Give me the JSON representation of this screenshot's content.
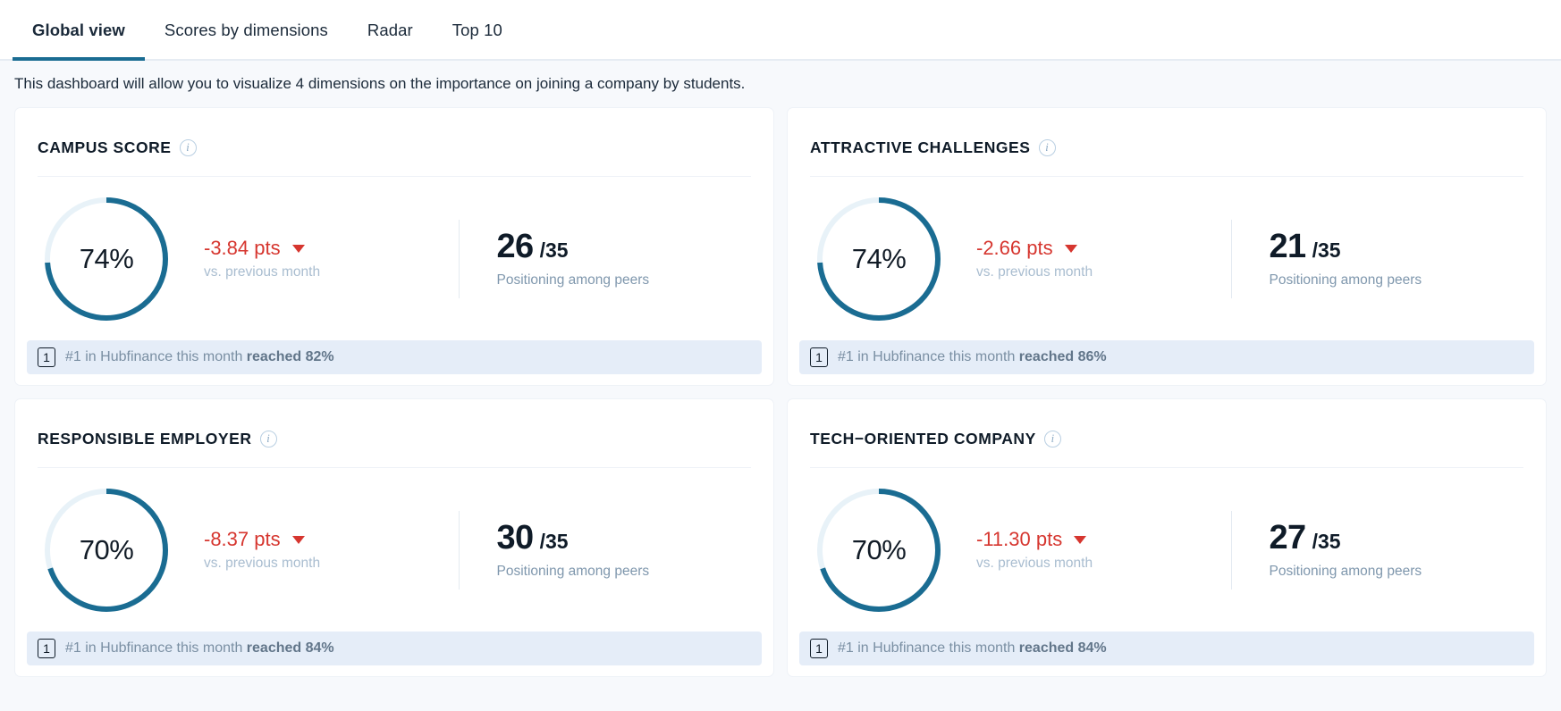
{
  "tabs": [
    {
      "label": "Global view",
      "active": true
    },
    {
      "label": "Scores by dimensions",
      "active": false
    },
    {
      "label": "Radar",
      "active": false
    },
    {
      "label": "Top 10",
      "active": false
    }
  ],
  "intro": "This dashboard will allow you to visualize 4 dimensions on the importance on joining a company by students.",
  "colors": {
    "accent": "#1a6c92",
    "track": "#e8f2f8",
    "negative": "#d6362f",
    "banner_bg": "#e5edf8"
  },
  "cards": [
    {
      "title": "CAMPUS SCORE",
      "score_pct": 74,
      "score_label": "74%",
      "delta": "-3.84 pts",
      "delta_caption": "vs. previous month",
      "rank_value": "26",
      "rank_total": "/35",
      "rank_caption": "Positioning among peers",
      "badge": "1",
      "banner_prefix": "#1 in Hubfinance this month ",
      "banner_strong": "reached 82%"
    },
    {
      "title": "ATTRACTIVE CHALLENGES",
      "score_pct": 74,
      "score_label": "74%",
      "delta": "-2.66 pts",
      "delta_caption": "vs. previous month",
      "rank_value": "21",
      "rank_total": "/35",
      "rank_caption": "Positioning among peers",
      "badge": "1",
      "banner_prefix": "#1 in Hubfinance this month ",
      "banner_strong": "reached 86%"
    },
    {
      "title": "RESPONSIBLE EMPLOYER",
      "score_pct": 70,
      "score_label": "70%",
      "delta": "-8.37 pts",
      "delta_caption": "vs. previous month",
      "rank_value": "30",
      "rank_total": "/35",
      "rank_caption": "Positioning among peers",
      "badge": "1",
      "banner_prefix": "#1 in Hubfinance this month ",
      "banner_strong": "reached 84%"
    },
    {
      "title": "TECH−ORIENTED COMPANY",
      "score_pct": 70,
      "score_label": "70%",
      "delta": "-11.30 pts",
      "delta_caption": "vs. previous month",
      "rank_value": "27",
      "rank_total": "/35",
      "rank_caption": "Positioning among peers",
      "badge": "1",
      "banner_prefix": "#1 in Hubfinance this month ",
      "banner_strong": "reached 84%"
    }
  ],
  "chart_data": [
    {
      "type": "pie",
      "title": "CAMPUS SCORE",
      "categories": [
        "score",
        "remainder"
      ],
      "values": [
        74,
        26
      ],
      "annotations": [
        "74%"
      ],
      "unit": "%"
    },
    {
      "type": "pie",
      "title": "ATTRACTIVE CHALLENGES",
      "categories": [
        "score",
        "remainder"
      ],
      "values": [
        74,
        26
      ],
      "annotations": [
        "74%"
      ],
      "unit": "%"
    },
    {
      "type": "pie",
      "title": "RESPONSIBLE EMPLOYER",
      "categories": [
        "score",
        "remainder"
      ],
      "values": [
        70,
        30
      ],
      "annotations": [
        "70%"
      ],
      "unit": "%"
    },
    {
      "type": "pie",
      "title": "TECH−ORIENTED COMPANY",
      "categories": [
        "score",
        "remainder"
      ],
      "values": [
        70,
        30
      ],
      "annotations": [
        "70%"
      ],
      "unit": "%"
    }
  ]
}
